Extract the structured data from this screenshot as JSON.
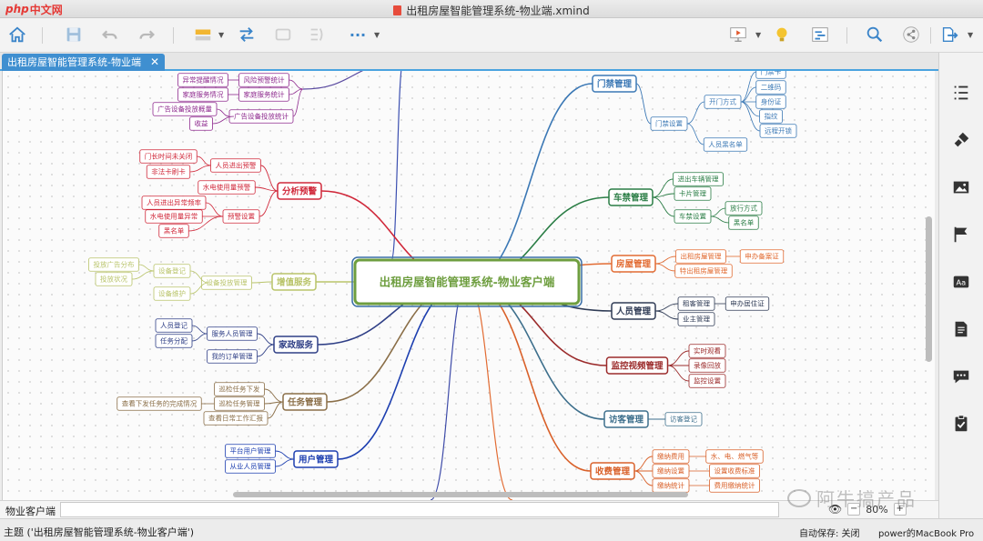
{
  "app": {
    "logo_php": "php",
    "logo_cn": "中文网",
    "window_title": "出租房屋智能管理系统-物业端.xmind",
    "tab_label": "出租房屋智能管理系统-物业端",
    "tab_close": "✕"
  },
  "toolbar": {
    "icons": [
      "home-icon",
      "save-icon",
      "undo-icon",
      "redo-icon",
      "insert-topic-icon",
      "relationship-icon",
      "boundary-icon",
      "summary-icon",
      "more-icon",
      "presentation-icon",
      "idea-icon",
      "gantt-icon",
      "search-icon",
      "share-icon",
      "export-icon"
    ],
    "more_label": "···"
  },
  "mindmap": {
    "center": "出租房屋智能管理系统-物业客户端",
    "top_partial": [
      {
        "leaf": "异常提醒情况",
        "mid": "风险预警统计"
      },
      {
        "leaf": "家庭服务情况",
        "mid": "家庭服务统计"
      },
      {
        "leaf": "广告设备投放概量",
        "mid": "广告设备投放统计"
      },
      {
        "leaf": "收益",
        "mid": ""
      }
    ],
    "left": [
      {
        "name": "分析预警",
        "color": "#d0283a",
        "groups": [
          {
            "label": "人员进出预警",
            "leaves": [
              "门长时间未关闭",
              "非法卡刷卡"
            ]
          },
          {
            "label": "水电使用量预警",
            "leaves": []
          },
          {
            "label": "预警设置",
            "leaves": [
              "人员进出异常频率",
              "水电使用量异常",
              "黑名单"
            ]
          }
        ]
      },
      {
        "name": "增值服务",
        "color": "#b9c46a",
        "groups": [
          {
            "label": "设备投放管理",
            "leaves": []
          },
          {
            "label": "设备登记",
            "leaves": [
              "投放广告分布",
              "投放状况"
            ]
          },
          {
            "label": "设备维护",
            "leaves": []
          }
        ]
      },
      {
        "name": "家政服务",
        "color": "#2f3f86",
        "groups": [
          {
            "label": "服务人员管理",
            "leaves": [
              "人员登记",
              "任务分配"
            ]
          },
          {
            "label": "我的订单管理",
            "leaves": []
          }
        ]
      },
      {
        "name": "任务管理",
        "color": "#8a6e47",
        "groups": [
          {
            "label": "巡检任务下发",
            "leaves": []
          },
          {
            "label": "巡检任务管理",
            "leaves": [
              "查看下发任务的完成情况"
            ]
          },
          {
            "label": "查看日常工作汇报",
            "leaves": []
          }
        ]
      },
      {
        "name": "用户管理",
        "color": "#1d3fb0",
        "groups": [
          {
            "label": "平台用户管理",
            "leaves": []
          },
          {
            "label": "从业人员管理",
            "leaves": []
          }
        ]
      }
    ],
    "right": [
      {
        "name": "门禁管理",
        "color": "#3b78b5",
        "groups": [
          {
            "label": "门禁设置",
            "sub": [
              {
                "label": "开门方式",
                "leaves": [
                  "门禁卡",
                  "二维码",
                  "身份证",
                  "指纹",
                  "远程开锁"
                ]
              },
              {
                "label": "人员黑名单",
                "leaves": []
              }
            ]
          }
        ]
      },
      {
        "name": "车禁管理",
        "color": "#2a7d45",
        "groups": [
          {
            "label": "进出车辆管理",
            "leaves": []
          },
          {
            "label": "卡片管理",
            "leaves": []
          },
          {
            "label": "车禁设置",
            "leaves": [
              "放行方式",
              "黑名单"
            ]
          }
        ]
      },
      {
        "name": "房屋管理",
        "color": "#e26b32",
        "groups": [
          {
            "label": "出租房屋管理",
            "leaves": [
              "申办备案证"
            ]
          },
          {
            "label": "特出租房屋管理",
            "leaves": []
          }
        ]
      },
      {
        "name": "人员管理",
        "color": "#2f3b55",
        "groups": [
          {
            "label": "租客管理",
            "leaves": [
              "申办居住证"
            ]
          },
          {
            "label": "业主管理",
            "leaves": []
          }
        ]
      },
      {
        "name": "监控视频管理",
        "color": "#9b2b2b",
        "groups": [
          {
            "label": "实时观看",
            "leaves": []
          },
          {
            "label": "录像回放",
            "leaves": []
          },
          {
            "label": "监控设置",
            "leaves": []
          }
        ]
      },
      {
        "name": "访客管理",
        "color": "#3d6f8c",
        "groups": [
          {
            "label": "访客登记",
            "leaves": []
          }
        ]
      },
      {
        "name": "收费管理",
        "color": "#d9612a",
        "groups": [
          {
            "label": "缴纳费用",
            "leaves": [
              "水、电、燃气等"
            ]
          },
          {
            "label": "缴纳设置",
            "leaves": [
              "设置收费标准"
            ]
          },
          {
            "label": "缴纳统计",
            "leaves": [
              "费用缴纳统计"
            ]
          }
        ]
      }
    ]
  },
  "footer": {
    "label": "物业客户端",
    "zoom": "80%",
    "zoom_minus": "−",
    "zoom_plus": "+"
  },
  "status": {
    "topic": "主题 ('出租房屋智能管理系统-物业客户端')",
    "autosave": "自动保存: 关闭",
    "device": "power的MacBook Pro"
  },
  "watermark": "阿牛搞产品"
}
